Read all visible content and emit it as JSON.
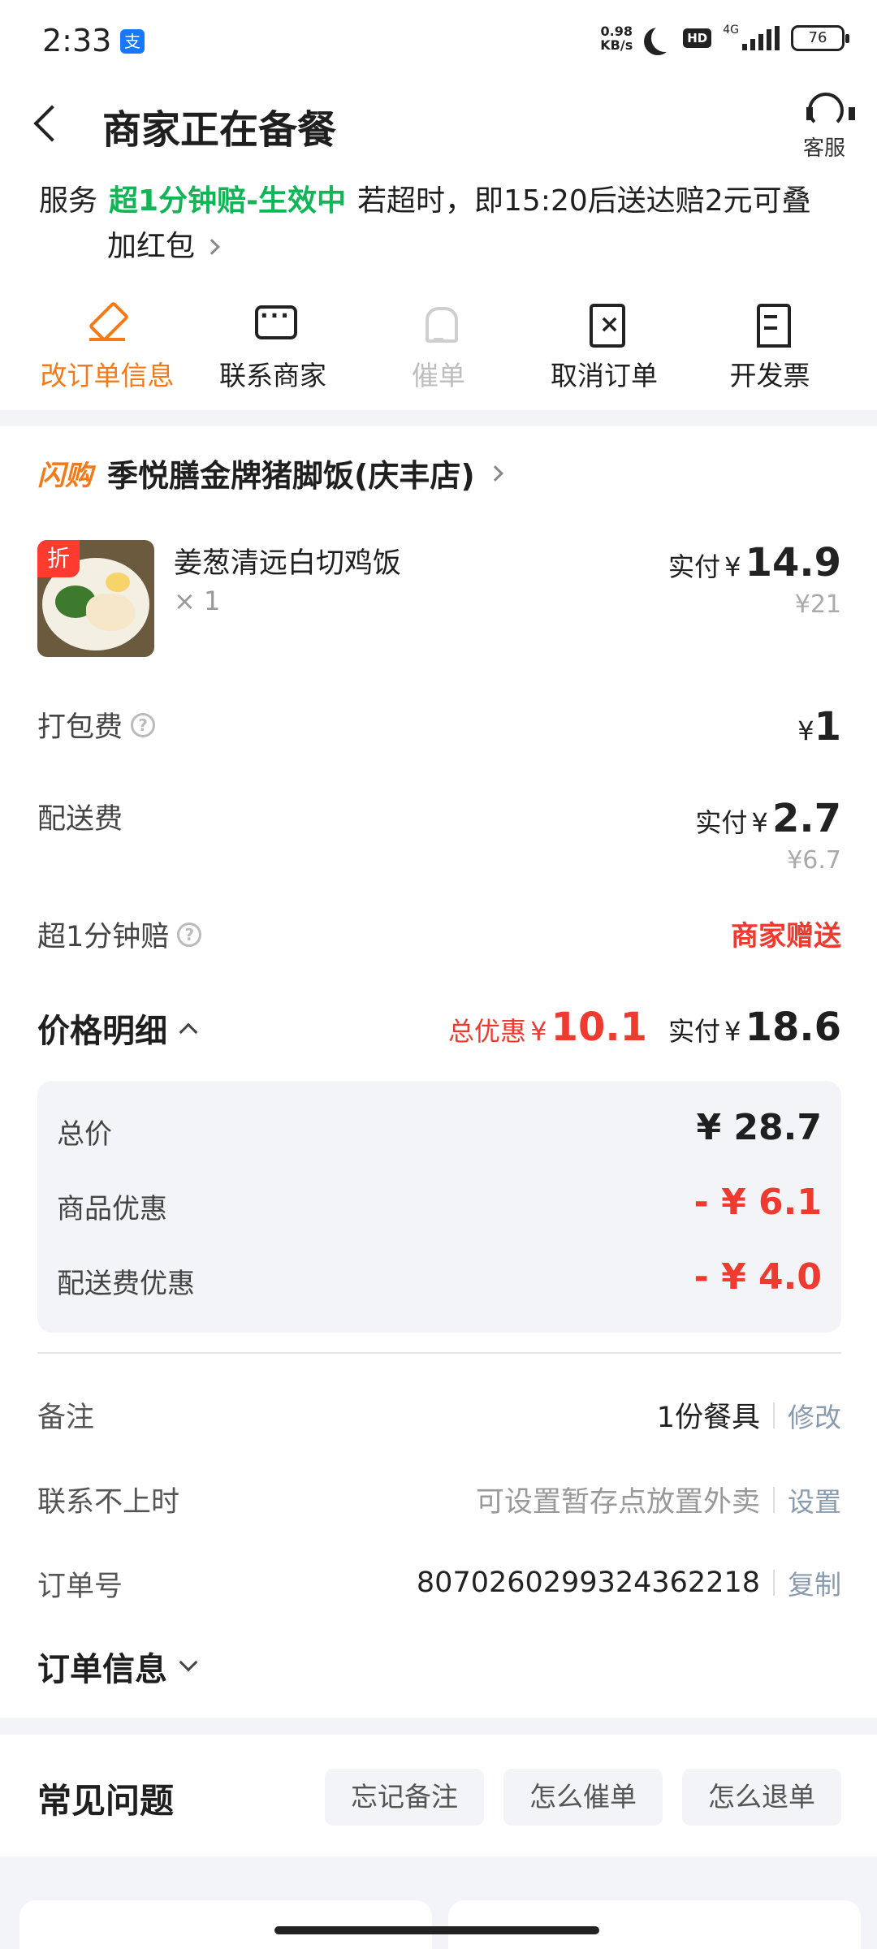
{
  "status_bar": {
    "time": "2:33",
    "alipay_glyph": "支",
    "speed_top": "0.98",
    "speed_bottom": "KB/s",
    "hd": "HD",
    "network": "4G",
    "battery": "76"
  },
  "header": {
    "title": "商家正在备餐",
    "customer_service": "客服"
  },
  "service": {
    "label": "服务",
    "highlight": "超1分钟赔-生效中",
    "text": "若超时，即15:20后送达赔2元可叠",
    "text_line2": "加红包"
  },
  "actions": [
    {
      "label": "改订单信息",
      "icon": "edit-icon"
    },
    {
      "label": "联系商家",
      "icon": "chat-icon"
    },
    {
      "label": "催单",
      "icon": "bell-icon"
    },
    {
      "label": "取消订单",
      "icon": "cancel-order-icon"
    },
    {
      "label": "开发票",
      "icon": "invoice-icon"
    }
  ],
  "shop": {
    "badge": "闪购",
    "name": "季悦膳金牌猪脚饭(庆丰店)"
  },
  "item": {
    "discount_tag": "折",
    "name": "姜葱清远白切鸡饭",
    "qty": "× 1",
    "paid_label": "实付",
    "currency": "¥",
    "paid": "14.9",
    "original": "¥21"
  },
  "fees": {
    "packing_label": "打包费",
    "packing_value": "1",
    "delivery_label": "配送费",
    "delivery_paid_label": "实付",
    "delivery_paid": "2.7",
    "delivery_original": "¥6.7",
    "late_label": "超1分钟赔",
    "late_value": "商家赠送"
  },
  "price_detail": {
    "title": "价格明细",
    "discount_label": "总优惠",
    "discount_value": "10.1",
    "paid_label": "实付",
    "paid_value": "18.6",
    "rows": [
      {
        "label": "总价",
        "value": "¥ 28.7"
      },
      {
        "label": "商品优惠",
        "value": "- ¥ 6.1"
      },
      {
        "label": "配送费优惠",
        "value": "- ¥ 4.0"
      }
    ]
  },
  "info": {
    "remark_label": "备注",
    "remark_value": "1份餐具",
    "remark_action": "修改",
    "unreachable_label": "联系不上时",
    "unreachable_value": "可设置暂存点放置外卖",
    "unreachable_action": "设置",
    "order_no_label": "订单号",
    "order_no": "8070260299324362218",
    "order_no_action": "复制",
    "order_info_title": "订单信息"
  },
  "faq": {
    "title": "常见问题",
    "chips": [
      "忘记备注",
      "怎么催单",
      "怎么退单"
    ]
  },
  "colors": {
    "accent_orange": "#f57a17",
    "green": "#10b655",
    "red": "#ef3a2f"
  }
}
